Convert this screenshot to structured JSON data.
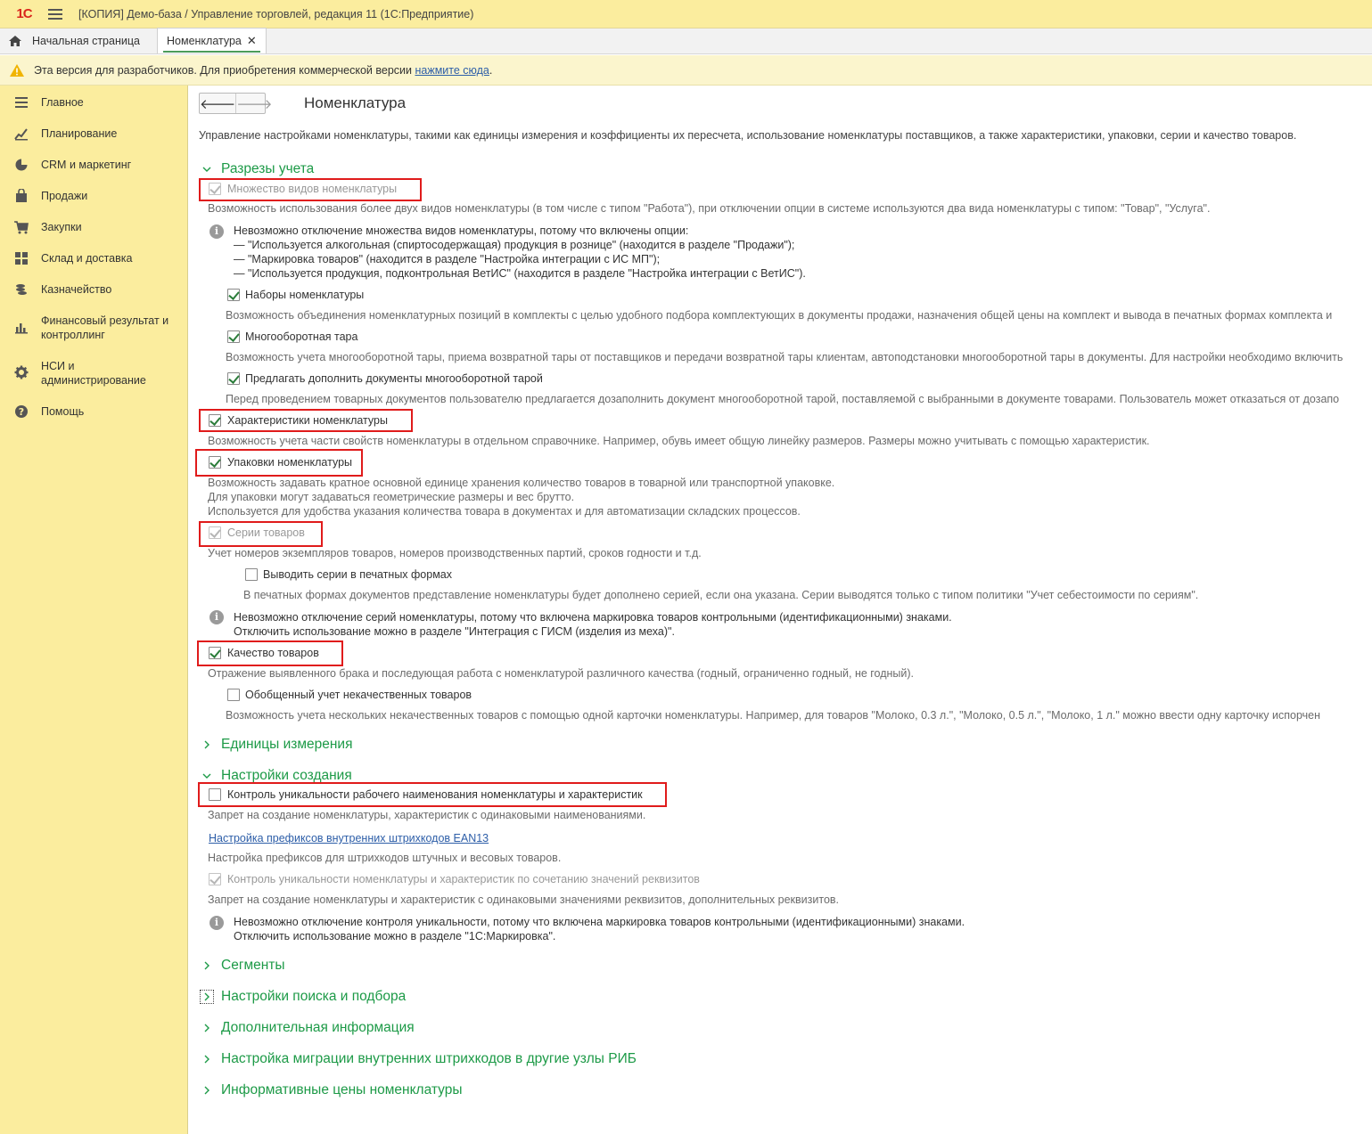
{
  "app": {
    "logo_text": "1С",
    "title": "[КОПИЯ] Демо-база / Управление торговлей, редакция 11  (1С:Предприятие)"
  },
  "tabs": {
    "home": "Начальная страница",
    "active": "Номенклатура",
    "close": "✕"
  },
  "warning": {
    "text": "Эта версия для разработчиков. Для приобретения коммерческой версии ",
    "link": "нажмите сюда",
    "suffix": "."
  },
  "sidebar": {
    "items": [
      {
        "label": "Главное",
        "icon": "menu-icon"
      },
      {
        "label": "Планирование",
        "icon": "planning-icon"
      },
      {
        "label": "CRM и маркетинг",
        "icon": "pie-chart-icon"
      },
      {
        "label": "Продажи",
        "icon": "bag-icon"
      },
      {
        "label": "Закупки",
        "icon": "cart-icon"
      },
      {
        "label": "Склад и доставка",
        "icon": "grid-icon"
      },
      {
        "label": "Казначейство",
        "icon": "coins-icon"
      },
      {
        "label": "Финансовый результат и",
        "label2": "контроллинг",
        "icon": "bar-chart-icon"
      },
      {
        "label": "НСИ и",
        "label2": "администрирование",
        "icon": "gear-icon"
      },
      {
        "label": "Помощь",
        "icon": "question-icon"
      }
    ]
  },
  "page": {
    "back": "🡐",
    "forward": "🡒",
    "title": "Номенклатура",
    "description": "Управление настройками номенклатуры, такими как единицы измерения и коэффициенты их пересчета, использование номенклатуры поставщиков, а также характеристики, упаковки, серии и качество товаров."
  },
  "accounting": {
    "title": "Разрезы учета",
    "many_kinds": {
      "label": "Множество видов номенклатуры",
      "checked": true,
      "hint": "Возможность использования более двух видов номенклатуры (в том числе с типом \"Работа\"), при отключении опции в системе используются два вида номенклатуры с типом: \"Товар\", \"Услуга\"."
    },
    "info1": {
      "l1": "Невозможно отключение множества видов номенклатуры, потому что включены опции:",
      "l2": "— \"Используется алкогольная (спиртосодержащая) продукция в рознице\" (находится в разделе \"Продажи\");",
      "l3": "— \"Маркировка товаров\" (находится в разделе \"Настройка интеграции с ИС МП\");",
      "l4": "— \"Используется продукция, подконтрольная ВетИС\" (находится в разделе \"Настройка интеграции с ВетИС\")."
    },
    "kits": {
      "label": "Наборы номенклатуры",
      "checked": true,
      "hint": "Возможность объединения номенклатурных позиций в комплекты с целью удобного подбора комплектующих в документы продажи, назначения общей цены на комплект и вывода в печатных формах комплекта и"
    },
    "tara": {
      "label": "Многооборотная тара",
      "checked": true,
      "hint": "Возможность учета многооборотной тары, приема возвратной тары от поставщиков и передачи возвратной тары клиентам, автоподстановки многооборотной тары в документы. Для настройки необходимо включить"
    },
    "suggest": {
      "label": "Предлагать дополнить документы многооборотной тарой",
      "checked": true,
      "hint": "Перед проведением товарных документов пользователю предлагается дозаполнить документ многооборотной тарой, поставляемой с выбранными в документе товарами. Пользователь может отказаться от дозапо"
    },
    "characteristics": {
      "label": "Характеристики номенклатуры",
      "checked": true,
      "hint": "Возможность учета части свойств номенклатуры в отдельном справочнике. Например, обувь имеет общую линейку размеров. Размеры можно учитывать с помощью характеристик."
    },
    "packages": {
      "label": "Упаковки номенклатуры",
      "checked": true,
      "hint1": "Возможность задавать кратное основной единице хранения количество товаров в товарной или транспортной упаковке.",
      "hint2": "Для упаковки могут задаваться геометрические размеры и вес брутто.",
      "hint3": "Используется для удобства указания количества товара в документах и для автоматизации складских процессов."
    },
    "series": {
      "label": "Серии товаров",
      "checked": true,
      "hint": "Учет номеров экземпляров товаров, номеров производственных партий, сроков годности и т.д."
    },
    "print_series": {
      "label": "Выводить серии в печатных формах",
      "checked": false,
      "hint": "В печатных формах документов представление номенклатуры будет дополнено серией, если она указана. Серии выводятся только с типом политики \"Учет себестоимости по сериям\"."
    },
    "info2": {
      "l1": "Невозможно отключение серий номенклатуры, потому что включена маркировка товаров контрольными (идентификационными) знаками.",
      "l2": "Отключить использование можно в разделе \"Интеграция с ГИСМ (изделия из меха)\"."
    },
    "quality": {
      "label": "Качество товаров",
      "checked": true,
      "hint": "Отражение выявленного брака и последующая работа с номенклатурой различного качества (годный, ограниченно годный, не годный)."
    },
    "defect": {
      "label": "Обобщенный учет некачественных товаров",
      "checked": false,
      "hint": "Возможность учета нескольких некачественных товаров с помощью одной карточки номенклатуры. Например, для товаров \"Молоко, 0.3 л.\", \"Молоко, 0.5 л.\", \"Молоко, 1 л.\" можно ввести одну карточку испорчен"
    }
  },
  "units": {
    "title": "Единицы измерения"
  },
  "creation": {
    "title": "Настройки создания",
    "unique_name": {
      "label": "Контроль уникальности рабочего наименования номенклатуры и характеристик",
      "checked": false,
      "hint": "Запрет на создание номенклатуры, характеристик с одинаковыми наименованиями."
    },
    "prefix_link": "Настройка префиксов внутренних штрихкодов EAN13",
    "prefix_hint": "Настройка префиксов для штрихкодов штучных и весовых товаров.",
    "unique_attrs": {
      "label": "Контроль уникальности номенклатуры и характеристик по сочетанию значений реквизитов",
      "checked": true,
      "hint": "Запрет на создание номенклатуры и характеристик с одинаковыми значениями реквизитов, дополнительных реквизитов."
    },
    "info3": {
      "l1": "Невозможно отключение контроля уникальности, потому что включена маркировка товаров контрольными (идентификационными) знаками.",
      "l2": "Отключить использование можно в разделе \"1С:Маркировка\"."
    }
  },
  "sections": {
    "segments": "Сегменты",
    "search": "Настройки поиска и подбора",
    "extra": "Дополнительная информация",
    "migration": "Настройка миграции внутренних штрихкодов в другие узлы РИБ",
    "prices": "Информативные цены номенклатуры"
  },
  "info_glyph": "i",
  "colors": {
    "accent": "#1d9a47",
    "highlight": "#e01b1b",
    "sidebar": "#fbed9e"
  }
}
